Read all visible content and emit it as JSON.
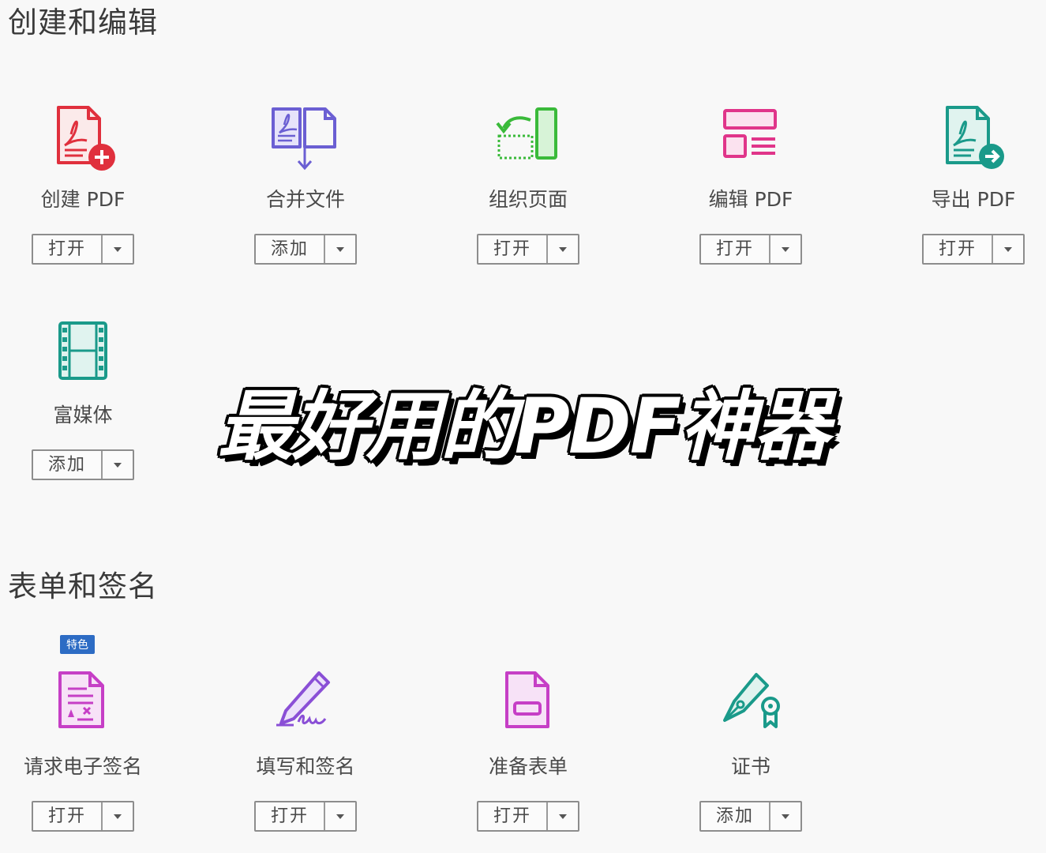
{
  "sections": {
    "create_edit": {
      "title": "创建和编辑",
      "tools": [
        {
          "name": "创建 PDF",
          "button": "打开",
          "icon": "create-pdf-icon",
          "color": "#e0303d"
        },
        {
          "name": "合并文件",
          "button": "添加",
          "icon": "combine-files-icon",
          "color": "#6b5fd3"
        },
        {
          "name": "组织页面",
          "button": "打开",
          "icon": "organize-pages-icon",
          "color": "#3aba3a"
        },
        {
          "name": "编辑 PDF",
          "button": "打开",
          "icon": "edit-pdf-icon",
          "color": "#e0358a"
        },
        {
          "name": "导出 PDF",
          "button": "打开",
          "icon": "export-pdf-icon",
          "color": "#1a9a8a"
        },
        {
          "name": "富媒体",
          "button": "添加",
          "icon": "rich-media-icon",
          "color": "#1a9a8a"
        }
      ]
    },
    "forms_signatures": {
      "title": "表单和签名",
      "tools": [
        {
          "name": "请求电子签名",
          "button": "打开",
          "icon": "request-signature-icon",
          "color": "#c63fc6",
          "badge": "特色"
        },
        {
          "name": "填写和签名",
          "button": "打开",
          "icon": "fill-sign-icon",
          "color": "#8a4fd6"
        },
        {
          "name": "准备表单",
          "button": "打开",
          "icon": "prepare-form-icon",
          "color": "#c63fc6"
        },
        {
          "name": "证书",
          "button": "添加",
          "icon": "certificate-icon",
          "color": "#1a9a8a"
        }
      ]
    }
  },
  "overlay_text": "最好用的PDF神器"
}
